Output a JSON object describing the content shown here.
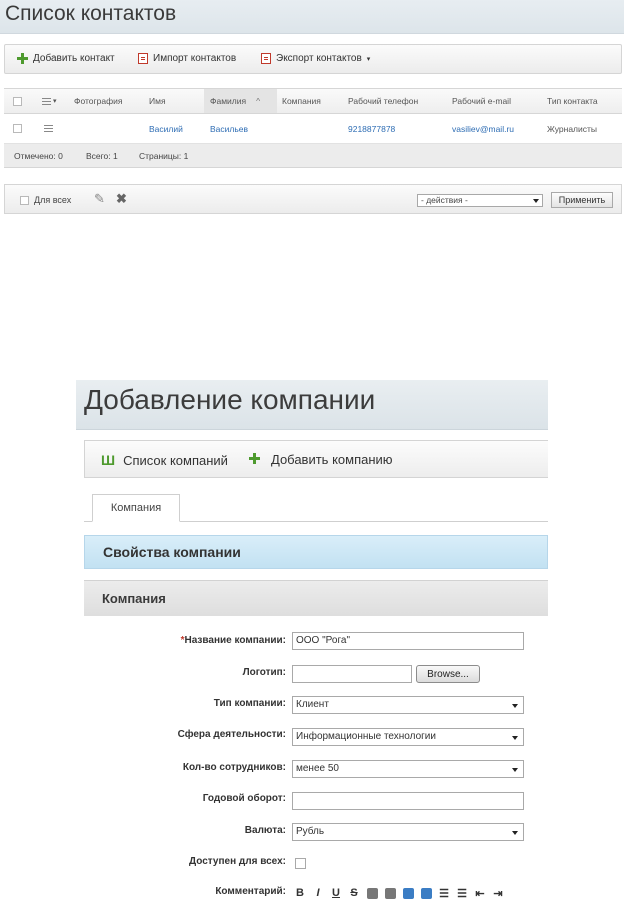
{
  "contacts": {
    "title": "Список контактов",
    "toolbar": {
      "add": "Добавить контакт",
      "import": "Импорт контактов",
      "export": "Экспорт контактов"
    },
    "columns": [
      "Фотография",
      "Имя",
      "Фамилия",
      "Компания",
      "Рабочий телефон",
      "Рабочий e-mail",
      "Тип контакта"
    ],
    "sorted_column_marker": "^",
    "row": {
      "photo": "",
      "first_name": "Василий",
      "last_name": "Васильев",
      "company": "",
      "phone": "9218877878",
      "email": "vasiliev@mail.ru",
      "type": "Журналисты"
    },
    "footer": {
      "checked": "Отмечено: 0",
      "total": "Всего: 1",
      "pages": "Страницы:  1"
    },
    "bottom": {
      "for_all": "Для всех",
      "actions_select": "- действия -",
      "apply": "Применить"
    }
  },
  "company": {
    "title": "Добавление компании",
    "toolbar": {
      "list": "Список компаний",
      "add": "Добавить компанию"
    },
    "tab": "Компания",
    "props_header": "Свойства компании",
    "section_header": "Компания",
    "fields": {
      "name_label": "Название компании:",
      "name_required": "*",
      "name_value": "ООО \"Рога\"",
      "logo_label": "Логотип:",
      "browse": "Browse...",
      "type_label": "Тип компании:",
      "type_value": "Клиент",
      "sphere_label": "Сфера деятельности:",
      "sphere_value": "Информационные технологии",
      "employees_label": "Кол-во сотрудников:",
      "employees_value": "менее 50",
      "turnover_label": "Годовой оборот:",
      "turnover_value": "",
      "currency_label": "Валюта:",
      "currency_value": "Рубль",
      "public_label": "Доступен для всех:",
      "comment_label": "Комментарий:"
    },
    "editor_buttons": [
      "B",
      "I",
      "U",
      "S"
    ]
  }
}
